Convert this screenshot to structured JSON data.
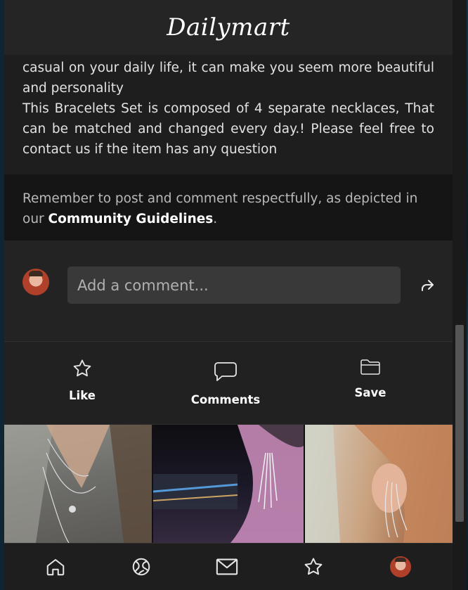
{
  "app": {
    "brand": "Dailymart"
  },
  "description": {
    "paragraph1": "casual on your daily life, it can make you seem more beautiful and personality",
    "paragraph2": "This Bracelets Set is composed of 4 separate necklaces, That can be matched and changed every day.! Please feel free to contact us if the item has any question"
  },
  "notice": {
    "text_before": "Remember to post and comment respectfully, as depicted in our ",
    "link_label": "Community Guidelines",
    "text_after": "."
  },
  "comment": {
    "placeholder": "Add a comment...",
    "avatar_icon": "user-avatar",
    "send_icon": "share-arrow-icon"
  },
  "actions": [
    {
      "label": "Like",
      "icon": "star-icon"
    },
    {
      "label": "Comments",
      "icon": "speech-bubble-icon"
    },
    {
      "label": "Save",
      "icon": "folder-icon"
    }
  ],
  "gallery": [
    {
      "icon": "photo-necklace-layered"
    },
    {
      "icon": "photo-crystal-earring-night"
    },
    {
      "icon": "photo-ear-cuff-chain"
    }
  ],
  "bottom_nav": [
    {
      "icon": "home-icon"
    },
    {
      "icon": "explore-globe-icon"
    },
    {
      "icon": "mail-icon"
    },
    {
      "icon": "star-icon"
    },
    {
      "icon": "profile-avatar"
    }
  ],
  "colors": {
    "background": "#232323",
    "header": "#252525",
    "notice_bg": "#151515",
    "input_bg": "#393939",
    "text": "#e2e2e2"
  }
}
